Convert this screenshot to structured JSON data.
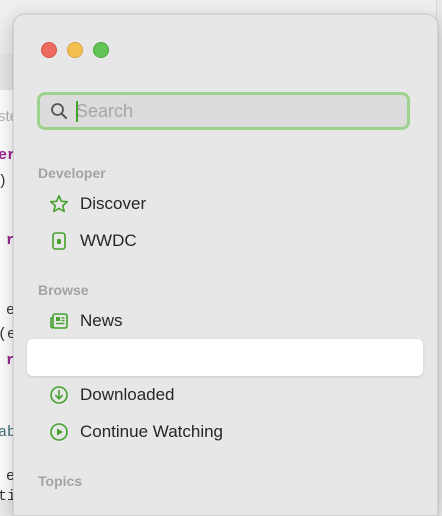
{
  "background_window": {
    "fragments": [
      "ste",
      "er",
      ")",
      "r",
      "e",
      "(e",
      "r",
      "ab",
      "e",
      "ti"
    ]
  },
  "sidebar": {
    "search": {
      "placeholder": "Search",
      "value": ""
    },
    "sections": [
      {
        "label": "Developer",
        "items": [
          {
            "label": "Discover",
            "icon": "star-icon"
          },
          {
            "label": "WWDC",
            "icon": "wwdc-icon"
          }
        ]
      },
      {
        "label": "Browse",
        "items": [
          {
            "label": "News",
            "icon": "newspaper-icon"
          },
          {
            "label": "",
            "icon": "",
            "selected": true
          },
          {
            "label": "Downloaded",
            "icon": "download-circle-icon"
          },
          {
            "label": "Continue Watching",
            "icon": "play-circle-icon"
          }
        ]
      },
      {
        "label": "Topics",
        "items": []
      }
    ]
  },
  "colors": {
    "accent": "#44a22c",
    "search_focus_ring": "#9dd38d",
    "section_label": "#a3a3a3",
    "panel_bg": "#e7e7e7"
  }
}
